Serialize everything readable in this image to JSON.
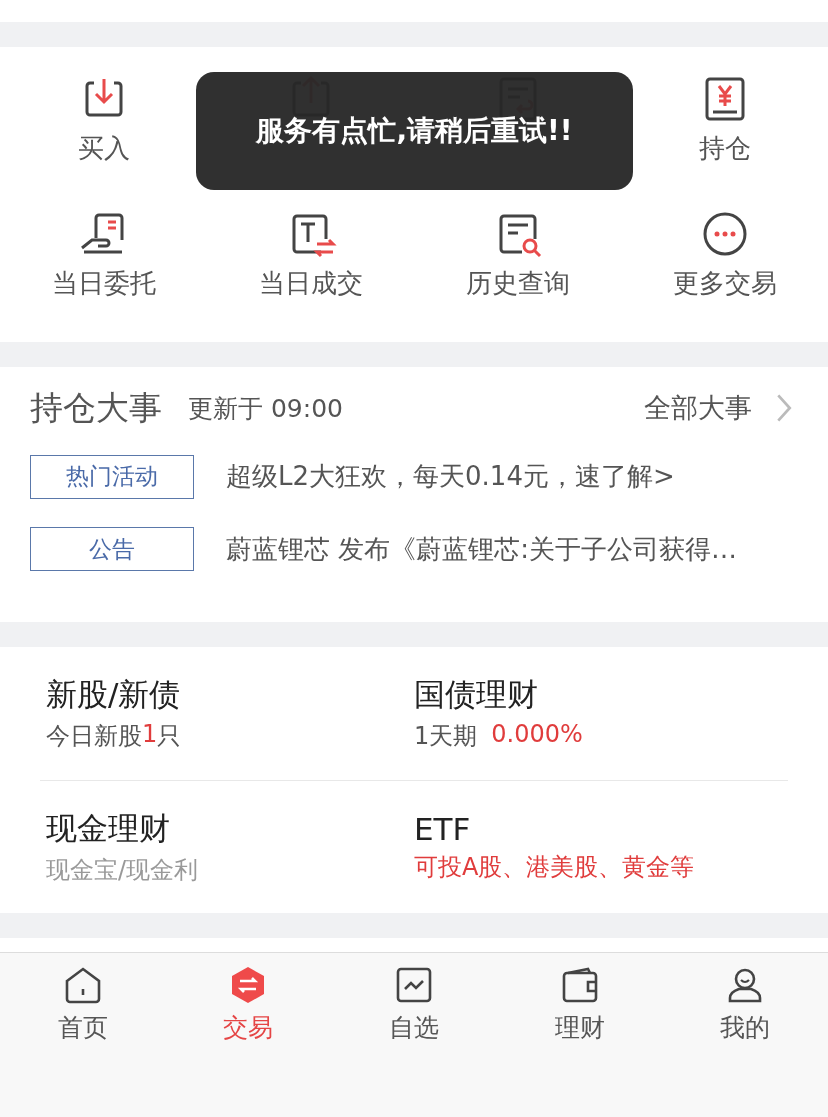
{
  "toast": {
    "text": "服务有点忙,请稍后重试!!"
  },
  "actions": [
    {
      "label": "买入",
      "kind": "buy"
    },
    {
      "kind": "sell"
    },
    {
      "kind": "cancel"
    },
    {
      "label": "持仓",
      "kind": "position"
    },
    {
      "label": "当日委托",
      "kind": "orders"
    },
    {
      "label": "当日成交",
      "kind": "deals"
    },
    {
      "label": "历史查询",
      "kind": "history"
    },
    {
      "label": "更多交易",
      "kind": "more"
    }
  ],
  "events": {
    "title": "持仓大事",
    "updated": "更新于 09:00",
    "link": "全部大事",
    "items": [
      {
        "tag": "热门活动",
        "text": "超级L2大狂欢，每天0.14元，速了解>"
      },
      {
        "tag": "公告",
        "text": "蔚蓝锂芯 发布《蔚蓝锂芯:关于子公司获得…"
      }
    ]
  },
  "products": [
    {
      "title": "新股/新债",
      "subtitle": [
        {
          "text": "今日新股",
          "color": "#555555"
        },
        {
          "text": "1",
          "color": "#e03c3c"
        },
        {
          "text": "只",
          "color": "#555555"
        }
      ]
    },
    {
      "title": "国债理财",
      "subtitle": [
        {
          "text": "1天期",
          "color": "#555555"
        },
        {
          "text": "0.000%",
          "color": "#e03c3c"
        }
      ]
    },
    {
      "title": "现金理财",
      "subtitle": [
        {
          "text": "现金宝/现金利",
          "color": "#999999"
        }
      ]
    },
    {
      "title": "ETF",
      "subtitle": [
        {
          "text": "可投A股、港美股、黄金等",
          "color": "#e03c3c"
        }
      ]
    }
  ],
  "tabs": [
    {
      "label": "首页",
      "kind": "home",
      "selected": false
    },
    {
      "label": "交易",
      "kind": "trade",
      "selected": true
    },
    {
      "label": "自选",
      "kind": "watch",
      "selected": false
    },
    {
      "label": "理财",
      "kind": "wallet",
      "selected": false
    },
    {
      "label": "我的",
      "kind": "me",
      "selected": false
    }
  ]
}
